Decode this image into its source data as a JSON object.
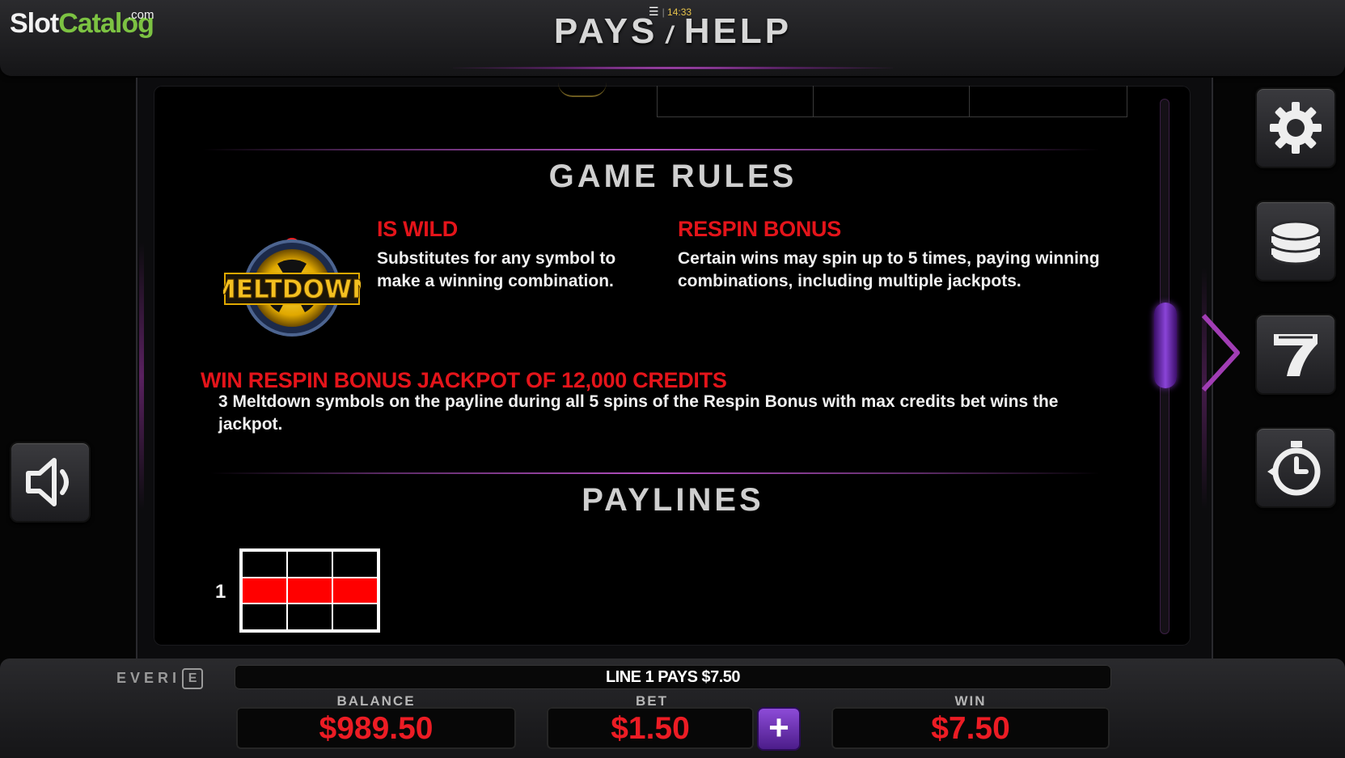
{
  "branding": {
    "logo_slot": "Slot",
    "logo_catalog": "Catalog",
    "logo_com": ".com",
    "provider": "EVERI",
    "provider_mark": "E"
  },
  "header": {
    "title_left": "PAYS",
    "title_sep": "/",
    "title_right": "HELP",
    "clock": "14:33"
  },
  "game_rules": {
    "title": "GAME RULES",
    "wild": {
      "heading": "IS WILD",
      "text": "Substitutes for any symbol to make a winning combination."
    },
    "respin": {
      "heading": "RESPIN BONUS",
      "text": "Certain wins may spin up to 5 times, paying winning combinations, including multiple jackpots."
    },
    "symbol_name": "MELTDOWN",
    "jackpot": {
      "heading": "WIN RESPIN BONUS JACKPOT OF 12,000 CREDITS",
      "text": "3 Meltdown symbols on the payline during all 5 spins of the Respin Bonus with max credits bet wins the jackpot."
    }
  },
  "paylines": {
    "title": "PAYLINES",
    "lines": [
      {
        "number": "1",
        "grid": [
          [
            0,
            0,
            0
          ],
          [
            1,
            1,
            1
          ],
          [
            0,
            0,
            0
          ]
        ]
      }
    ]
  },
  "status": {
    "message": "LINE 1 PAYS $7.50"
  },
  "meters": {
    "balance_label": "BALANCE",
    "balance_value": "$989.50",
    "bet_label": "BET",
    "bet_value": "$1.50",
    "bet_plus": "+",
    "win_label": "WIN",
    "win_value": "$7.50"
  },
  "buttons": {
    "settings": "gear-icon",
    "coins": "coin-stack-icon",
    "paytable": "seven-icon",
    "autoplay": "stopwatch-icon",
    "sound": "speaker-icon",
    "menu": "hamburger-icon"
  },
  "colors": {
    "accent_red": "#e4141a",
    "accent_purple": "#8a44d8",
    "payline_red": "#ff0000"
  }
}
